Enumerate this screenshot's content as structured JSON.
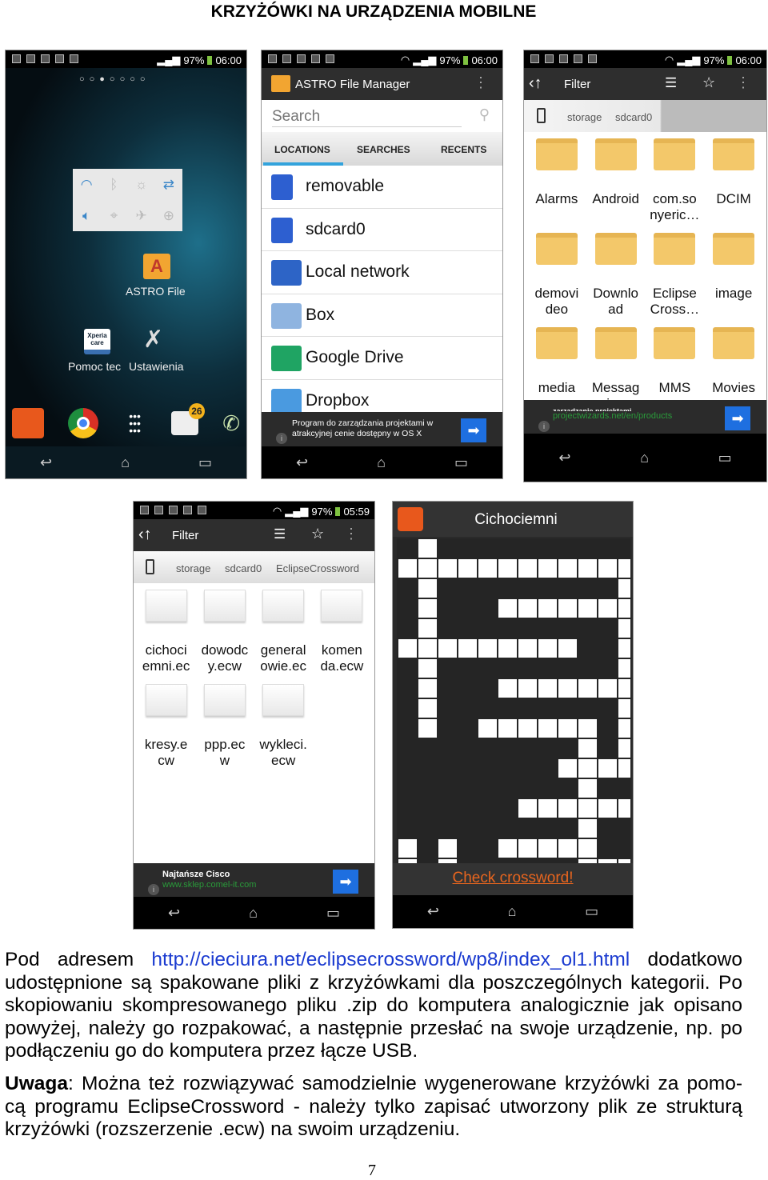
{
  "title": "KRZYŻÓWKI NA URZĄDZENIA MOBILNE",
  "status": {
    "battery": "97%",
    "time1": "06:00",
    "time4": "05:59"
  },
  "home": {
    "astro_label": "ASTRO File",
    "xperia_label": "Pomoc tec",
    "settings_label": "Ustawienia",
    "badge": "26",
    "xperia_icon_text": "Xperia care"
  },
  "astro": {
    "title": "ASTRO File Manager",
    "search_placeholder": "Search",
    "tabs": [
      "LOCATIONS",
      "SEARCHES",
      "RECENTS"
    ],
    "items": [
      "removable",
      "sdcard0",
      "Local network",
      "Box",
      "Google Drive",
      "Dropbox"
    ],
    "ad": "Program do zarządzania projektami w\natrakcyjnej cenie dostępny w OS X"
  },
  "browser": {
    "filter": "Filter",
    "crumbs": [
      "storage",
      "sdcard0"
    ],
    "folders": [
      "Alarms",
      "Android",
      "com.so\nnyeric…",
      "DCIM",
      "demovi\ndeo",
      "Downlo\nad",
      "Eclipse\nCross…",
      "image",
      "media",
      "Messag\ning",
      "MMS",
      "Movies"
    ],
    "ad_line1": "zarządzanie projektami",
    "ad_line2": "projectwizards.net/en/products"
  },
  "files": {
    "filter": "Filter",
    "crumbs": [
      "storage",
      "sdcard0",
      "EclipseCrossword"
    ],
    "items": [
      "cichoci\nemni.ec",
      "dowodc\ny.ecw",
      "general\nowie.ec",
      "komen\nda.ecw",
      "kresy.e\ncw",
      "ppp.ec\nw",
      "wykleci.\necw"
    ],
    "ad_line1": "Najtańsze Cisco",
    "ad_line2": "www.sklep.comel-it.com"
  },
  "crossword": {
    "title": "Cichociemni",
    "check": "Check crossword!",
    "accent": "#e8651e",
    "grid": [
      "010000000000",
      "111111111111",
      "010000000001",
      "010001111111",
      "010000000001",
      "111111111001",
      "010000000001",
      "010001111111",
      "010000000001",
      "010011111101",
      "000000000101",
      "000000001111",
      "000000000100",
      "000000111111",
      "000000000100",
      "101001111100",
      "101000000111"
    ]
  },
  "text": {
    "l1a": "Pod   adresem  ",
    "link": "http://cieciura.net/eclipsecrossword/wp8/index_ol1.html",
    "l1b": "  dodatkowo",
    "l2": "udostępnione są spakowane pliki z krzyżówkami dla poszczególnych kategorii. Po",
    "l3": "skopiowaniu skompresowanego pliku .zip  do komputera analogicznie jak opisano",
    "l4": "powyżej, należy go rozpakować, a następnie przesłać na swoje urządzenie, np. po",
    "l5": "podłączeniu go do komputera przez łącze USB.",
    "uwaga": "Uwaga",
    "l6": ": Można też rozwiązywać samodzielnie wygenerowane krzyżówki za pomo-",
    "l7": "cą programu EclipseCrossword - należy tylko zapisać utworzony plik ze strukturą",
    "l8": "krzyżówki (rozszerzenie .ecw) na swoim urządzeniu."
  },
  "page_number": "7",
  "colors": {
    "tab_underline": "#33a3dc",
    "folder": "#f3c86a",
    "ad_button": "#1e6fe0",
    "ad_link": "#2a9a3a"
  }
}
